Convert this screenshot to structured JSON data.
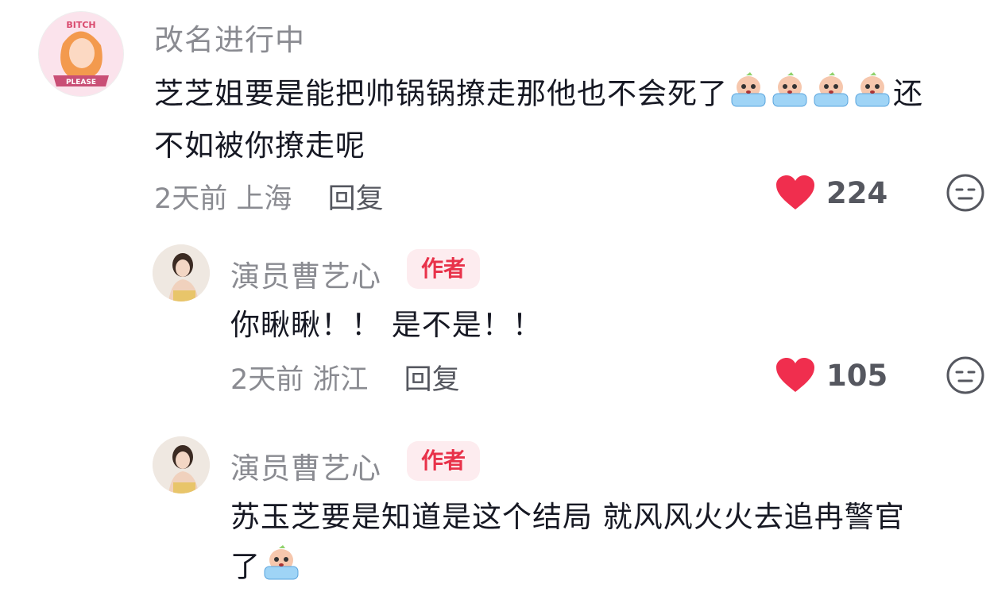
{
  "colors": {
    "like": "#f02e4e",
    "muted": "#8a8b91",
    "badge_bg": "#fdecef",
    "badge_text": "#e8324a"
  },
  "comments": [
    {
      "username": "改名进行中",
      "avatar_text_top": "BITCH",
      "avatar_text_bottom": "PLEASE",
      "text_line1": "芝芝姐要是能把帅锅锅撩走那他也不会死了",
      "text_after_emoji": "还",
      "text_line2": "不如被你撩走呢",
      "emoji": "crying-emoji",
      "time": "2天前",
      "location": "上海",
      "reply_label": "回复",
      "likes": "224"
    },
    {
      "username": "演员曹艺心",
      "badge": "作者",
      "text_line1": "你瞅瞅！！ 是不是！！",
      "time": "2天前",
      "location": "浙江",
      "reply_label": "回复",
      "likes": "105"
    },
    {
      "username": "演员曹艺心",
      "badge": "作者",
      "text_line1": "苏玉芝要是知道是这个结局 就风风火火去追冉警官",
      "text_line2": "了",
      "emoji": "crying-emoji"
    }
  ]
}
